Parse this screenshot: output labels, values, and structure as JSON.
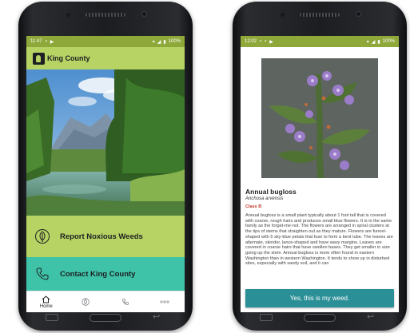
{
  "left_screen": {
    "status_bar": {
      "time": "11:47",
      "battery": "100%"
    },
    "header": {
      "brand": "King County"
    },
    "cards": [
      {
        "label": "Report Noxious Weeds",
        "icon": "leaf-icon"
      },
      {
        "label": "Contact King County",
        "icon": "phone-icon"
      }
    ],
    "bottom_nav": [
      {
        "label": "Home",
        "icon": "home-icon",
        "active": true
      },
      {
        "label": "",
        "icon": "leaf-icon",
        "active": false
      },
      {
        "label": "",
        "icon": "phone-icon",
        "active": false
      },
      {
        "label": "",
        "icon": "more-icon",
        "active": false
      }
    ]
  },
  "right_screen": {
    "status_bar": {
      "time": "12:02",
      "battery": "100%"
    },
    "plant": {
      "name": "Annual bugloss",
      "scientific_name": "Anchusa arvensis",
      "class": "Class B",
      "description": "Annual bugloss is a small plant typically about 1 foot tall that is covered with coarse, rough hairs and produces small blue flowers. It is in the same family as the forget-me-not. The flowers are arranged in spiral clusters at the tips of stems that straighten out as they mature. Flowers are funnel-shaped with 5 sky-blue petals that fuse to form a bent tube. The leaves are alternate, slender, lance-shaped and have wavy margins. Leaves are covered in coarse hairs that have swollen bases. They get smaller in size going up the stem. Annual bugloss is more often found in eastern Washington than in western Washington. It tends to show up in disturbed sites, especially with sandy soil, and it can"
    },
    "confirm_button": "Yes, this is my weed."
  },
  "colors": {
    "lime": "#b7d364",
    "teal": "#3fc3a8",
    "status_green": "#8ea83a",
    "button_teal": "#2a8f96",
    "class_red": "#c0392b"
  }
}
